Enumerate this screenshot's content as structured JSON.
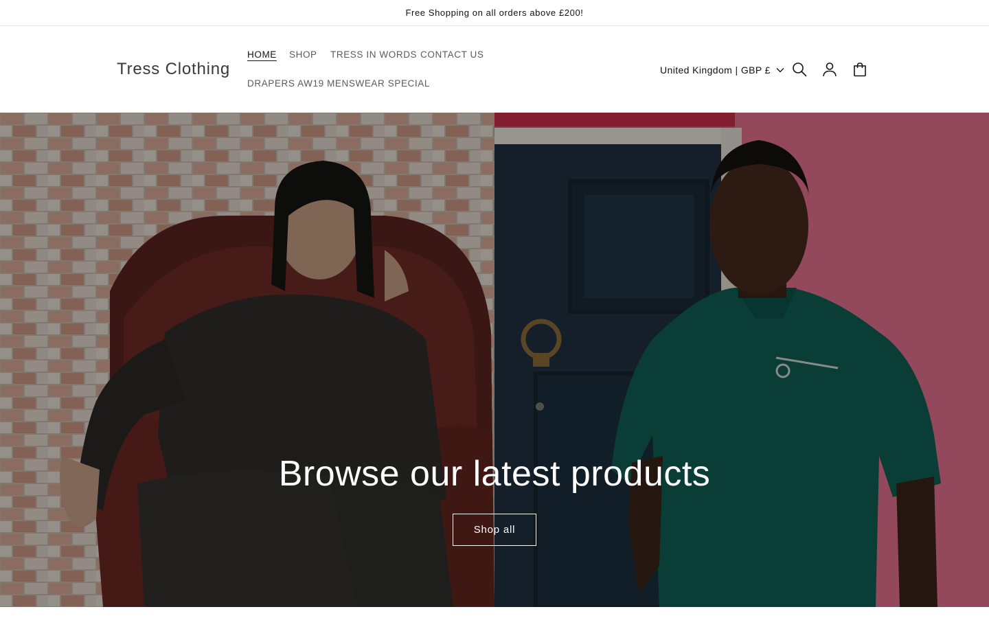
{
  "announcement": {
    "text": "Free Shopping on all orders above £200!"
  },
  "header": {
    "logo": "Tress Clothing",
    "nav": [
      {
        "label": "HOME",
        "active": true
      },
      {
        "label": "SHOP",
        "active": false
      },
      {
        "label": "TRESS IN WORDS",
        "active": false
      },
      {
        "label": "CONTACT US",
        "active": false
      },
      {
        "label": "DRAPERS AW19 MENSWEAR SPECIAL",
        "active": false
      }
    ],
    "country_selector": "United Kingdom | GBP £",
    "icons": [
      "search-icon",
      "account-icon",
      "cart-icon"
    ]
  },
  "hero": {
    "heading": "Browse our latest products",
    "button_label": "Shop all",
    "left_image": "man-in-leather-armchair",
    "right_image": "man-in-teal-tshirt-by-door"
  },
  "colors": {
    "text": "#121212",
    "nav_text": "#5a5a5a",
    "overlay": "rgba(0,0,0,0.35)",
    "divider": "#e6e6e6"
  }
}
